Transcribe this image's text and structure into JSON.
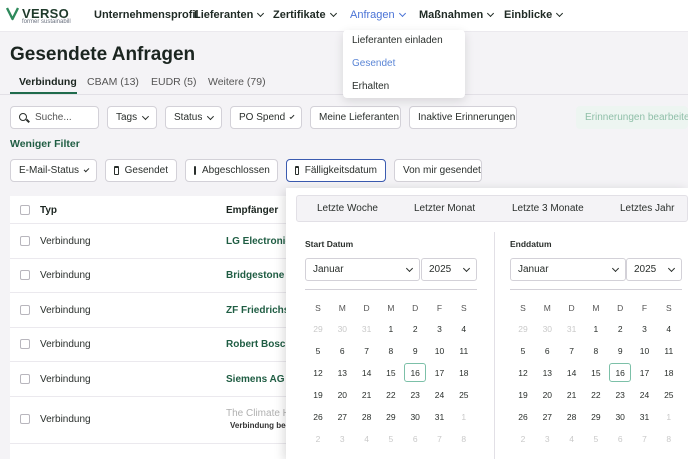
{
  "nav": {
    "brand": "VERSO",
    "brand_sub": "former sustainabill",
    "items": [
      {
        "label": "Unternehmensprofil",
        "dropdown": false
      },
      {
        "label": "Lieferanten",
        "dropdown": true
      },
      {
        "label": "Zertifikate",
        "dropdown": true
      },
      {
        "label": "Anfragen",
        "dropdown": true,
        "active": true
      },
      {
        "label": "Maßnahmen",
        "dropdown": true
      },
      {
        "label": "Einblicke",
        "dropdown": true
      }
    ],
    "anfragen_menu": [
      "Lieferanten einladen",
      "Gesendet",
      "Erhalten"
    ],
    "anfragen_menu_selected": "Gesendet"
  },
  "page": {
    "title": "Gesendete Anfragen",
    "tabs": [
      "Verbindung",
      "CBAM (13)",
      "EUDR (5)",
      "Weitere (79)"
    ],
    "active_tab": "Verbindung"
  },
  "filters": {
    "search_placeholder": "Suche...",
    "tags": "Tags",
    "status": "Status",
    "po_spend": "PO Spend",
    "my_suppliers": "Meine Lieferanten",
    "inactive_reminders": "Inaktive Erinnerungen",
    "edit_reminders": "Erinnerungen bearbeiten",
    "less_filters": "Weniger Filter",
    "email_status": "E-Mail-Status",
    "sent": "Gesendet",
    "completed": "Abgeschlossen",
    "due_date": "Fälligkeitsdatum",
    "sent_by_me": "Von mir gesendet"
  },
  "table": {
    "headers": {
      "type": "Typ",
      "recipient": "Empfänger"
    },
    "rows": [
      {
        "type": "Verbindung",
        "recipient": "LG Electronics"
      },
      {
        "type": "Verbindung",
        "recipient": "Bridgestone"
      },
      {
        "type": "Verbindung",
        "recipient": "ZF Friedrichsh"
      },
      {
        "type": "Verbindung",
        "recipient": "Robert Bosch"
      },
      {
        "type": "Verbindung",
        "recipient": "Siemens AG"
      },
      {
        "type": "Verbindung",
        "recipient": "The Climate H",
        "note": "Verbindung been"
      }
    ]
  },
  "datepicker": {
    "quick": [
      "Letzte Woche",
      "Letzter Monat",
      "Letzte 3 Monate",
      "Letztes Jahr"
    ],
    "start_label": "Start Datum",
    "end_label": "Enddatum",
    "start_month": "Januar",
    "start_year": "2025",
    "end_month": "Januar",
    "end_year": "2025",
    "weekdays": [
      "S",
      "M",
      "D",
      "M",
      "D",
      "F",
      "S"
    ],
    "weeks": [
      [
        "29",
        "30",
        "31",
        "1",
        "2",
        "3",
        "4"
      ],
      [
        "5",
        "6",
        "7",
        "8",
        "9",
        "10",
        "11"
      ],
      [
        "12",
        "13",
        "14",
        "15",
        "16",
        "17",
        "18"
      ],
      [
        "19",
        "20",
        "21",
        "22",
        "23",
        "24",
        "25"
      ],
      [
        "26",
        "27",
        "28",
        "29",
        "30",
        "31",
        "1"
      ],
      [
        "2",
        "3",
        "4",
        "5",
        "6",
        "7",
        "8"
      ]
    ],
    "today": "16"
  }
}
